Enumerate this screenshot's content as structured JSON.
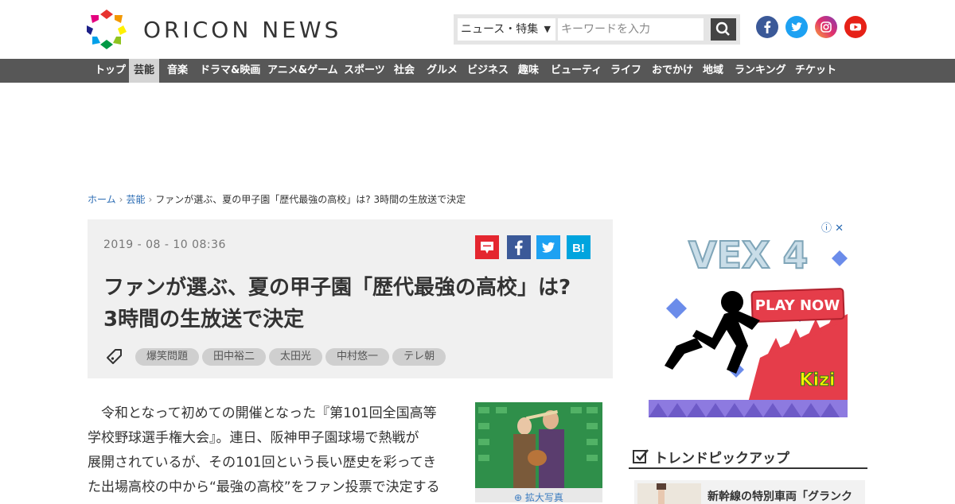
{
  "header": {
    "logo_text": "ORICON NEWS",
    "search": {
      "category": "ニュース・特集",
      "placeholder": "キーワードを入力"
    },
    "social": [
      "facebook-icon",
      "twitter-icon",
      "instagram-icon",
      "youtube-icon"
    ]
  },
  "nav": {
    "items": [
      "トップ",
      "芸能",
      "音楽",
      "ドラマ&映画",
      "アニメ&ゲーム",
      "スポーツ",
      "社会",
      "グルメ",
      "ビジネス",
      "趣味",
      "ビューティ",
      "ライフ",
      "おでかけ",
      "地域",
      "ランキング",
      "チケット"
    ],
    "active": "芸能"
  },
  "breadcrumb": {
    "home": "ホーム",
    "category": "芸能",
    "current": "ファンが選ぶ、夏の甲子園「歴代最強の高校」は? 3時間の生放送で決定"
  },
  "article": {
    "date": "2019 - 08 - 10  08:36",
    "title_line1": "ファンが選ぶ、夏の甲子園「歴代最強の高校」は?",
    "title_line2": "3時間の生放送で決定",
    "tags": [
      "爆笑問題",
      "田中裕二",
      "太田光",
      "中村悠一",
      "テレ朝"
    ],
    "body_lines": [
      "　令和となって初めての開催となった『第101回全国高等",
      "学校野球選手権大会』。連日、阪神甲子園球場で熱戦が",
      "展開されているが、その101回という長い歴史を彩ってき",
      "た出場高校の中から“最強の高校”をファン投票で決定する"
    ],
    "photo_caption": "拡大写真"
  },
  "ad": {
    "game_title": "VEX 4",
    "cta": "PLAY NOW",
    "brand": "Kizi"
  },
  "trend": {
    "title": "トレンドピックアップ",
    "items": [
      "新幹線の特別車両「グランク"
    ]
  },
  "colors": {
    "nav_bg": "#575757",
    "nav_active_bg": "#d4d4d4",
    "link": "#2a6bb3",
    "article_box_bg": "#f0f0f0"
  }
}
